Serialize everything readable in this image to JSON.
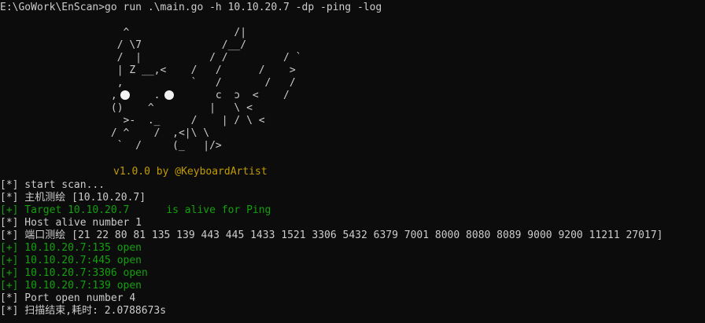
{
  "command_line": "E:\\GoWork\\EnScan>go run .\\main.go -h 10.10.20.7 -dp -ping -log",
  "ascii_art": [
    "                    ^                 /|",
    "                   / \\7             /__/",
    "                   /  |           / /         / `",
    "                   | Z __,<    /   /      /    >",
    "                   ,           `   /       /   /",
    "                  ,      .         c  ɔ  <    /",
    "                  ()    ^         |   \\ <",
    "                    >-  ._     /    | / \\ <",
    "                  / ^    /  ,<|\\ \\",
    "                   `  /     (_   |/>"
  ],
  "banner": "v1.0.0 by @KeyboardArtist",
  "output_lines": [
    {
      "text": "[*] start scan...",
      "color": "#cccccc"
    },
    {
      "text": "[*] 主机测绘 [10.10.20.7]",
      "color": "#cccccc"
    },
    {
      "text": "[+] Target 10.10.20.7      is alive for Ping",
      "color": "#13a10e"
    },
    {
      "text": "[*] Host alive number 1",
      "color": "#cccccc"
    },
    {
      "text": "[*] 端口测绘 [21 22 80 81 135 139 443 445 1433 1521 3306 5432 6379 7001 8000 8080 8089 9000 9200 11211 27017]",
      "color": "#cccccc"
    },
    {
      "text": "[+] 10.10.20.7:135 open",
      "color": "#13a10e"
    },
    {
      "text": "[+] 10.10.20.7:445 open",
      "color": "#13a10e"
    },
    {
      "text": "[+] 10.10.20.7:3306 open",
      "color": "#13a10e"
    },
    {
      "text": "[+] 10.10.20.7:139 open",
      "color": "#13a10e"
    },
    {
      "text": "[*] Port open number 4",
      "color": "#cccccc"
    },
    {
      "text": "[*] 扫描结束,耗时: 2.0788673s",
      "color": "#cccccc"
    }
  ],
  "colors": {
    "background": "#0c0c0c",
    "text": "#cccccc",
    "green": "#13a10e",
    "yellow": "#c19c00"
  }
}
